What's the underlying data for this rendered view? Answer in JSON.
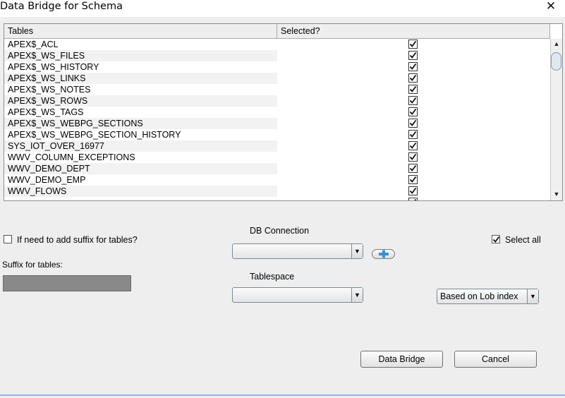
{
  "window": {
    "title": "Data Bridge for Schema",
    "close_icon": "✕"
  },
  "table": {
    "columns": [
      "Tables",
      "Selected?"
    ],
    "rows": [
      {
        "name": "APEX$_ACL",
        "selected": true
      },
      {
        "name": "APEX$_WS_FILES",
        "selected": true
      },
      {
        "name": "APEX$_WS_HISTORY",
        "selected": true
      },
      {
        "name": "APEX$_WS_LINKS",
        "selected": true
      },
      {
        "name": "APEX$_WS_NOTES",
        "selected": true
      },
      {
        "name": "APEX$_WS_ROWS",
        "selected": true
      },
      {
        "name": "APEX$_WS_TAGS",
        "selected": true
      },
      {
        "name": "APEX$_WS_WEBPG_SECTIONS",
        "selected": true
      },
      {
        "name": "APEX$_WS_WEBPG_SECTION_HISTORY",
        "selected": true
      },
      {
        "name": "SYS_IOT_OVER_16977",
        "selected": true
      },
      {
        "name": "WWV_COLUMN_EXCEPTIONS",
        "selected": true
      },
      {
        "name": "WWV_DEMO_DEPT",
        "selected": true
      },
      {
        "name": "WWV_DEMO_EMP",
        "selected": true
      },
      {
        "name": "WWV_FLOWS",
        "selected": true
      }
    ],
    "partial_row_selected": true
  },
  "options": {
    "suffix_checkbox_label": "If need to add suffix for tables?",
    "suffix_checked": false,
    "suffix_label": "Suffix for tables:",
    "suffix_value": "",
    "db_connection_label": "DB Connection",
    "db_connection_value": "",
    "tablespace_label": "Tablespace",
    "tablespace_value": "",
    "select_all_label": "Select all",
    "select_all_checked": true,
    "lob_option_value": "Based on Lob index"
  },
  "buttons": {
    "data_bridge": "Data Bridge",
    "cancel": "Cancel"
  },
  "colors": {
    "accent": "#3a8fd6",
    "alt_row": "#f2f2f2",
    "disabled_field": "#898989"
  }
}
